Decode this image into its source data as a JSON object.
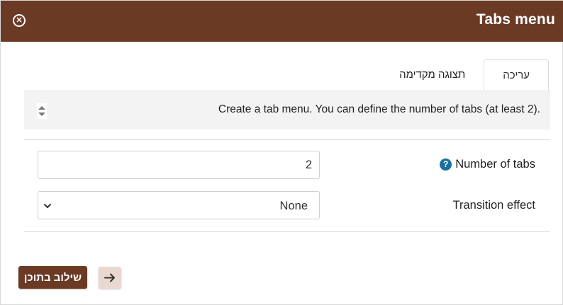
{
  "dialog": {
    "title": "Tabs menu"
  },
  "tabs": [
    {
      "label": "עריכה",
      "active": true
    },
    {
      "label": "תצוגה מקדימה",
      "active": false
    }
  ],
  "info": {
    "description": "Create a tab menu. You can define the number of tabs (at least 2)."
  },
  "fields": {
    "number_of_tabs": {
      "label": "Number of tabs",
      "value": "2",
      "help": "?"
    },
    "transition_effect": {
      "label": "Transition effect",
      "value": "None"
    }
  },
  "footer": {
    "insert_label": "שילוב בתוכן"
  },
  "icons": {
    "close": "close-circle-icon",
    "sort": "sort-updown-icon",
    "help": "help-circle-icon",
    "chevron": "chevron-down-icon",
    "arrow": "arrow-right-icon"
  },
  "colors": {
    "brand": "#6b3a24",
    "help": "#1b6fa0",
    "arrow_button_bg": "#ead7d0"
  }
}
